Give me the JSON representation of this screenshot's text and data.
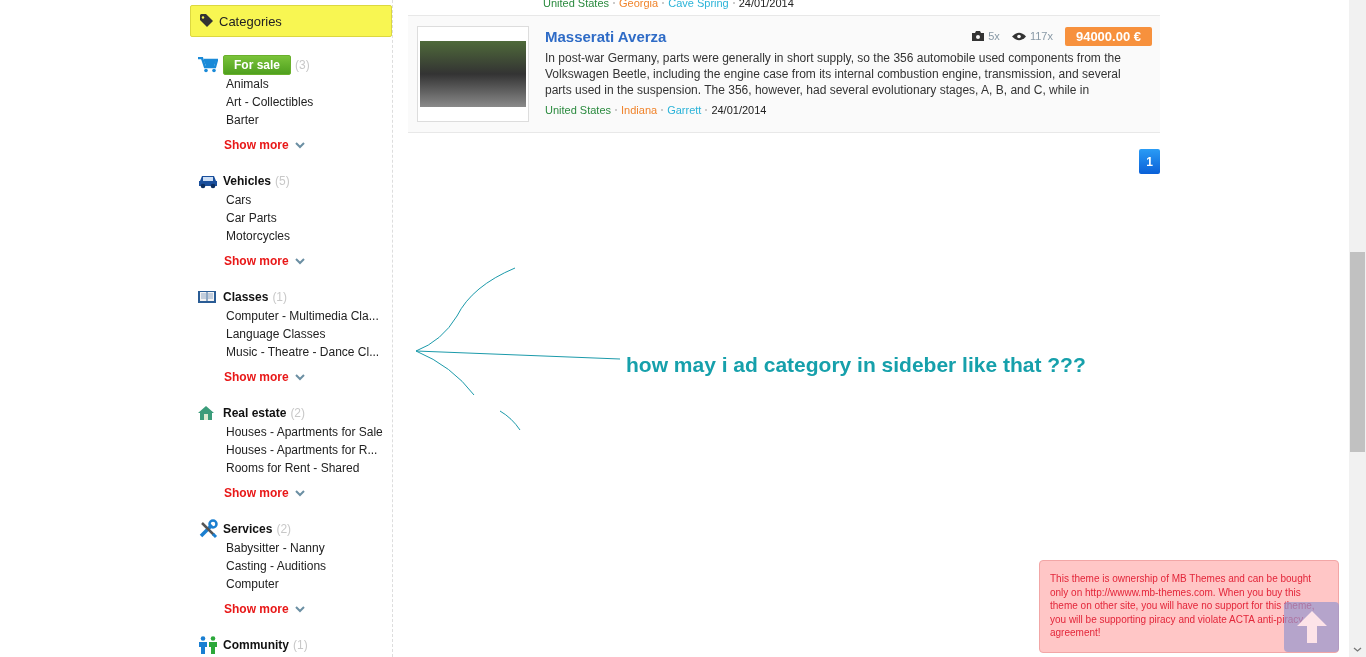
{
  "sidebar": {
    "title": "Categories",
    "categories": [
      {
        "name": "For sale",
        "count": "(3)",
        "selected": true,
        "items": [
          "Animals",
          "Art - Collectibles",
          "Barter"
        ],
        "show_more": "Show more"
      },
      {
        "name": "Vehicles",
        "count": "(5)",
        "selected": false,
        "items": [
          "Cars",
          "Car Parts",
          "Motorcycles"
        ],
        "show_more": "Show more"
      },
      {
        "name": "Classes",
        "count": "(1)",
        "selected": false,
        "items": [
          "Computer - Multimedia Cla...",
          "Language Classes",
          "Music - Theatre - Dance Cl..."
        ],
        "show_more": "Show more"
      },
      {
        "name": "Real estate",
        "count": "(2)",
        "selected": false,
        "items": [
          "Houses - Apartments for Sale",
          "Houses - Apartments for R...",
          "Rooms for Rent - Shared"
        ],
        "show_more": "Show more"
      },
      {
        "name": "Services",
        "count": "(2)",
        "selected": false,
        "items": [
          "Babysitter - Nanny",
          "Casting - Auditions",
          "Computer"
        ],
        "show_more": "Show more"
      },
      {
        "name": "Community",
        "count": "(1)",
        "selected": false
      }
    ]
  },
  "listings": [
    {
      "kind": "partial",
      "country": "United States",
      "region": "Georgia",
      "city": "Cave Spring",
      "date": "24/01/2014"
    },
    {
      "kind": "full",
      "title": "Masserati Averza",
      "photos": "5x",
      "views": "117x",
      "price": "94000.00 €",
      "description": "In post-war Germany, parts were generally in short supply, so the 356 automobile used components from the Volkswagen Beetle, including the engine case from its internal combustion engine, transmission, and several parts used in the suspension. The 356, however, had several evolutionary stages, A, B, and C, while in",
      "country": "United States",
      "region": "Indiana",
      "city": "Garrett",
      "date": "24/01/2014"
    }
  ],
  "pagination": [
    {
      "label": "1",
      "selected": true
    }
  ],
  "annotation": {
    "text": "how may i ad category in sideber like that ???"
  },
  "notice": {
    "text": "This theme is ownership of MB Themes and can be bought only on http://wwww.mb-themes.com. When you buy this theme on other site, you will have no support for this theme, you will be supporting piracy and violate ACTA anti-piracy agreement!"
  }
}
